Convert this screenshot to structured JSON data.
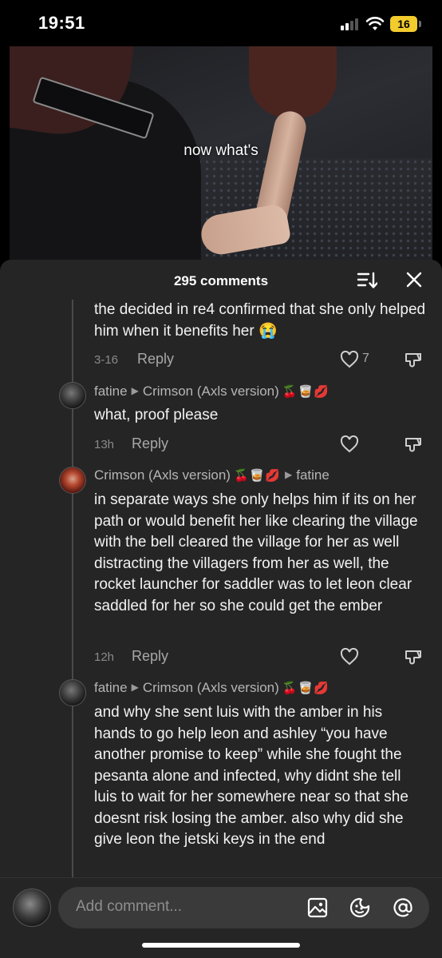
{
  "status_bar": {
    "time": "19:51",
    "battery": "16",
    "signal_icon": "cellular-signal-icon",
    "wifi_icon": "wifi-icon"
  },
  "video": {
    "caption": "now what's"
  },
  "comments_header": {
    "count_label": "295 comments",
    "sort_icon": "sort-icon",
    "close_icon": "close-icon"
  },
  "comments": [
    {
      "text": "the decided in re4 confirmed that she only helped him when it benefits her 😭",
      "time": "3-16",
      "reply_label": "Reply",
      "likes": "7"
    },
    {
      "author": "fatine",
      "reply_to": "Crimson (Axls version)",
      "reply_to_emoji": "🍒🥃💋",
      "text": "what, proof please",
      "time": "13h",
      "reply_label": "Reply"
    },
    {
      "author": "Crimson (Axls version)",
      "author_emoji": "🍒🥃💋",
      "reply_to": "fatine",
      "text": "in separate ways she only helps him if its on her path or would benefit her like clearing the village with the bell cleared the village for her as well distracting the villagers from her as well, the rocket launcher for saddler was to let leon clear saddled for her so she could get the ember",
      "time": "12h",
      "reply_label": "Reply"
    },
    {
      "author": "fatine",
      "reply_to": "Crimson (Axls version)",
      "reply_to_emoji": "🍒🥃💋",
      "text": "and why she sent luis with the amber in his hands to go help leon and ashley “you have another promise to keep” while she fought the pesanta alone and infected, why didnt she tell luis to wait for her somewhere near so that she doesnt risk losing the amber. also why did she give leon the jetski keys in the end"
    }
  ],
  "input_bar": {
    "placeholder": "Add comment...",
    "icons": [
      "image-icon",
      "emoji-icon",
      "mention-icon"
    ]
  },
  "colors": {
    "panel_bg": "#252525",
    "input_bg": "#3a3a3a",
    "battery": "#f2cb2d",
    "muted_text": "#a8a8a8"
  }
}
